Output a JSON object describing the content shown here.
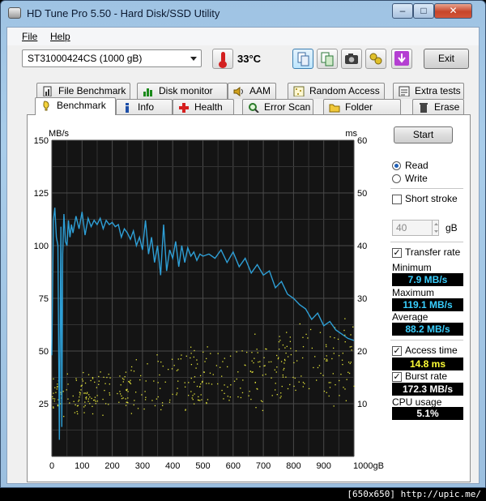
{
  "window": {
    "title": "HD Tune Pro 5.50 - Hard Disk/SSD Utility",
    "min": "–",
    "max": "□",
    "close": "✕"
  },
  "menu": {
    "file": "File",
    "help": "Help"
  },
  "toolbar": {
    "drive": "ST31000424CS (1000 gB)",
    "temperature": "33°C",
    "exit": "Exit"
  },
  "icons": {
    "app": "hard-disk-icon",
    "thermo": "thermometer-icon",
    "copy": "copy-icon",
    "copy_screen": "copy-screenshot-icon",
    "camera": "camera-icon",
    "options": "options-icon",
    "save": "save-download-icon"
  },
  "tabs": {
    "row1": [
      {
        "label": "File Benchmark",
        "icon": "file-benchmark-icon"
      },
      {
        "label": "Disk monitor",
        "icon": "disk-monitor-icon"
      },
      {
        "label": "AAM",
        "icon": "speaker-icon"
      },
      {
        "label": "Random Access",
        "icon": "random-access-icon"
      },
      {
        "label": "Extra tests",
        "icon": "extra-tests-icon"
      }
    ],
    "row2": [
      {
        "label": "Benchmark",
        "icon": "benchmark-icon",
        "selected": true
      },
      {
        "label": "Info",
        "icon": "info-icon"
      },
      {
        "label": "Health",
        "icon": "health-cross-icon"
      },
      {
        "label": "Error Scan",
        "icon": "magnifier-icon"
      },
      {
        "label": "Folder Usage",
        "icon": "folder-icon"
      },
      {
        "label": "Erase",
        "icon": "trash-icon"
      }
    ]
  },
  "side": {
    "start": "Start",
    "read": "Read",
    "write": "Write",
    "short_stroke": "Short stroke",
    "stroke_value": "40",
    "stroke_unit": "gB",
    "transfer_rate": "Transfer rate",
    "minimum_label": "Minimum",
    "minimum": "7.9 MB/s",
    "maximum_label": "Maximum",
    "maximum": "119.1 MB/s",
    "average_label": "Average",
    "average": "88.2 MB/s",
    "access_time": "Access time",
    "access_value": "14.8 ms",
    "burst_rate": "Burst rate",
    "burst_value": "172.3 MB/s",
    "cpu_usage": "CPU usage",
    "cpu_value": "5.1%"
  },
  "chart_data": {
    "type": "line",
    "ylabel": "MB/s",
    "y2label": "ms",
    "ylim": [
      0,
      150
    ],
    "y2lim": [
      0,
      60
    ],
    "xlim": [
      0,
      1000
    ],
    "xticks": [
      "0",
      "100",
      "200",
      "300",
      "400",
      "500",
      "600",
      "700",
      "800",
      "900",
      "1000gB"
    ],
    "yticks": [
      25,
      50,
      75,
      100,
      125,
      150
    ],
    "y2ticks": [
      10,
      20,
      30,
      40,
      50,
      60
    ],
    "grid": true,
    "transfer_series": {
      "name": "Transfer rate",
      "color": "#2e9fd6",
      "x": [
        0,
        5,
        10,
        15,
        20,
        25,
        30,
        33,
        36,
        40,
        45,
        50,
        55,
        60,
        65,
        70,
        80,
        90,
        100,
        110,
        120,
        130,
        140,
        150,
        160,
        170,
        180,
        190,
        200,
        210,
        220,
        230,
        240,
        250,
        260,
        270,
        280,
        290,
        300,
        310,
        320,
        330,
        340,
        350,
        360,
        370,
        380,
        390,
        400,
        410,
        420,
        430,
        440,
        450,
        460,
        470,
        480,
        490,
        500,
        520,
        540,
        560,
        580,
        600,
        620,
        640,
        660,
        680,
        700,
        720,
        740,
        760,
        780,
        800,
        820,
        840,
        860,
        880,
        900,
        920,
        940,
        960,
        980,
        1000
      ],
      "values": [
        48,
        112,
        118,
        104,
        100,
        7.9,
        109,
        14,
        96,
        115,
        102,
        100,
        112,
        104,
        110,
        106,
        114,
        108,
        116,
        105,
        113,
        109,
        112,
        110,
        113,
        108,
        112,
        110,
        111,
        109,
        110,
        104,
        108,
        106,
        103,
        107,
        100,
        104,
        98,
        112,
        96,
        104,
        92,
        100,
        86,
        110,
        88,
        98,
        94,
        102,
        90,
        100,
        92,
        99,
        95,
        97,
        93,
        96,
        95,
        96,
        94,
        98,
        92,
        97,
        90,
        94,
        87,
        91,
        86,
        88,
        80,
        83,
        77,
        75,
        72,
        70,
        65,
        68,
        62,
        64,
        60,
        58,
        56,
        55
      ]
    },
    "access_series": {
      "name": "Access time",
      "color": "#e4e43a",
      "unit": "ms",
      "x_range": [
        0,
        1000
      ],
      "y_min_start": 8,
      "y_max_start": 15,
      "y_min_end": 10,
      "y_max_end": 27,
      "count": 420
    },
    "access_trend": [
      {
        "x": 0,
        "y_min": 8,
        "y_max": 15
      },
      {
        "x": 500,
        "y_min": 9,
        "y_max": 22
      },
      {
        "x": 1000,
        "y_min": 10,
        "y_max": 27
      }
    ]
  },
  "watermark": "[650x650] http://upic.me/"
}
